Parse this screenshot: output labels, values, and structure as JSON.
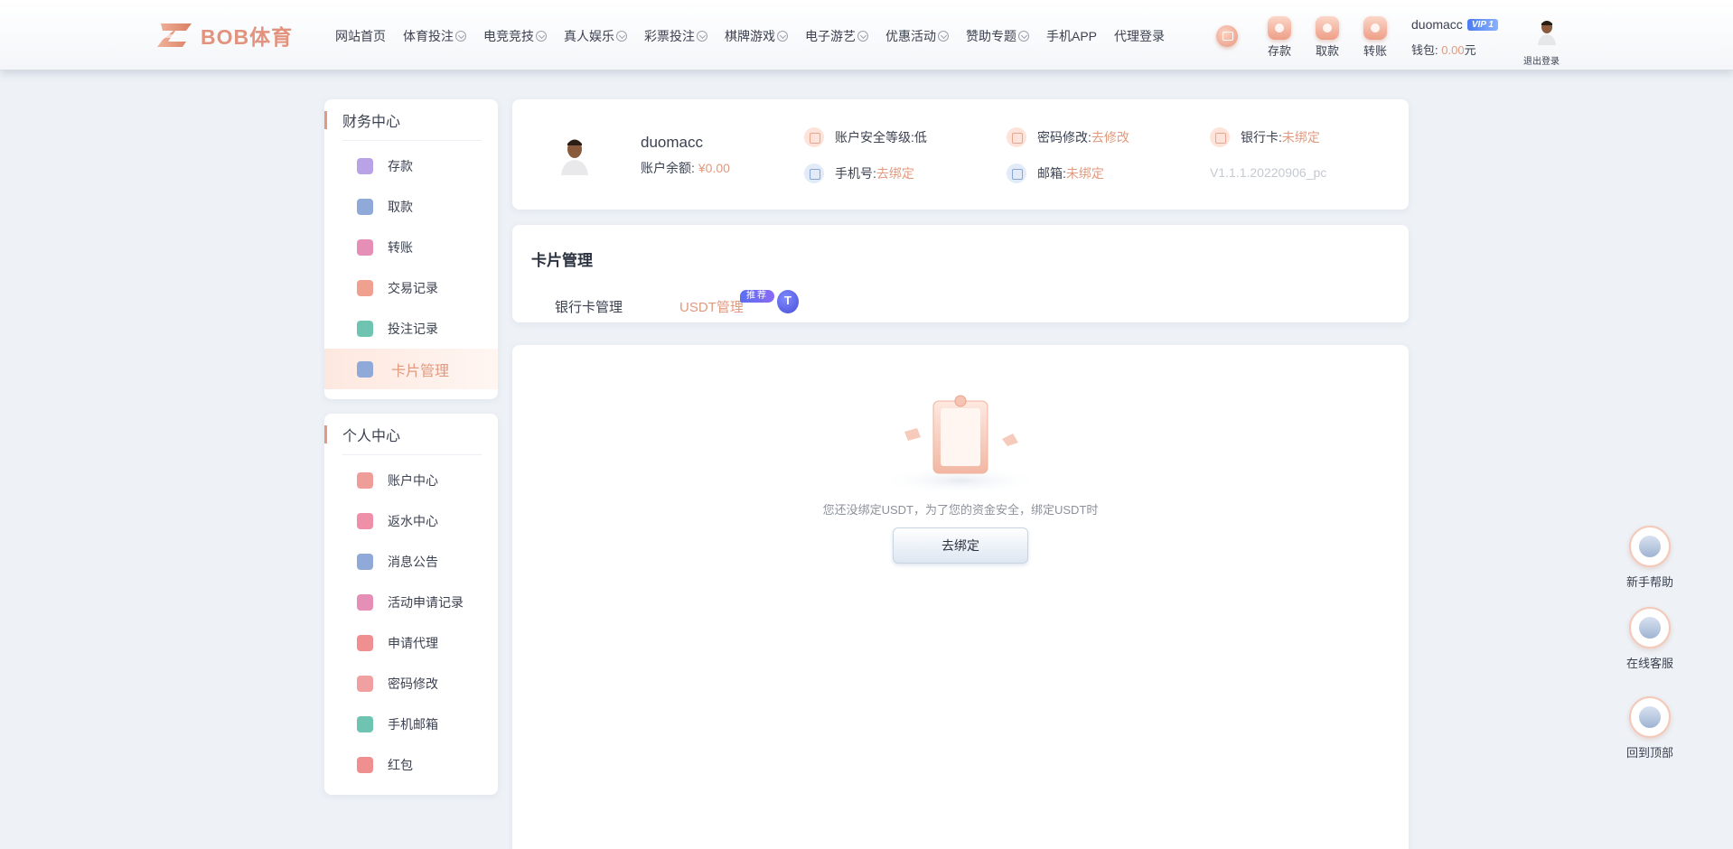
{
  "brand": {
    "name": "BOB体育"
  },
  "nav": [
    {
      "label": "网站首页",
      "caret": false
    },
    {
      "label": "体育投注",
      "caret": true
    },
    {
      "label": "电竞竞技",
      "caret": true
    },
    {
      "label": "真人娱乐",
      "caret": true
    },
    {
      "label": "彩票投注",
      "caret": true
    },
    {
      "label": "棋牌游戏",
      "caret": true
    },
    {
      "label": "电子游艺",
      "caret": true
    },
    {
      "label": "优惠活动",
      "caret": true
    },
    {
      "label": "赞助专题",
      "caret": true
    },
    {
      "label": "手机APP",
      "caret": false
    },
    {
      "label": "代理登录",
      "caret": false
    }
  ],
  "quick": {
    "deposit": "存款",
    "withdraw": "取款",
    "transfer": "转账"
  },
  "user": {
    "name": "duomacc",
    "vip": "VIP 1",
    "wallet_label": "钱包:",
    "wallet_amount": "0.00",
    "wallet_unit": "元",
    "logout": "退出登录"
  },
  "sidebar": {
    "finance_title": "财务中心",
    "finance_items": [
      {
        "label": "存款",
        "color": "#b9a3e6"
      },
      {
        "label": "取款",
        "color": "#8fa9d9"
      },
      {
        "label": "转账",
        "color": "#e68fb6"
      },
      {
        "label": "交易记录",
        "color": "#f0a08f"
      },
      {
        "label": "投注记录",
        "color": "#6fc3b1"
      },
      {
        "label": "卡片管理",
        "color": "#8fa9d9",
        "active": true
      }
    ],
    "personal_title": "个人中心",
    "personal_items": [
      {
        "label": "账户中心",
        "color": "#ef9d98"
      },
      {
        "label": "返水中心",
        "color": "#ef8fa8"
      },
      {
        "label": "消息公告",
        "color": "#8fa9d9"
      },
      {
        "label": "活动申请记录",
        "color": "#e68fb6"
      },
      {
        "label": "申请代理",
        "color": "#f08f8f"
      },
      {
        "label": "密码修改",
        "color": "#f0a0a0"
      },
      {
        "label": "手机邮箱",
        "color": "#6fc3b1"
      },
      {
        "label": "红包",
        "color": "#f08f8f"
      }
    ]
  },
  "profile": {
    "name": "duomacc",
    "balance_label": "账户余额:",
    "balance": "¥0.00",
    "security_label": "账户安全等级:",
    "security_value": "低",
    "password_label": "密码修改:",
    "password_action": "去修改",
    "bank_label": "银行卡:",
    "bank_value": "未绑定",
    "phone_label": "手机号:",
    "phone_action": "去绑定",
    "email_label": "邮箱:",
    "email_value": "未绑定",
    "version": "V1.1.1.20220906_pc"
  },
  "cards": {
    "title": "卡片管理",
    "tab_bank": "银行卡管理",
    "tab_usdt": "USDT管理",
    "badge": "推荐",
    "usdt_symbol": "T"
  },
  "empty": {
    "message": "您还没绑定USDT，为了您的资金安全，绑定USDT时",
    "button": "去绑定"
  },
  "float": {
    "help": "新手帮助",
    "service": "在线客服",
    "top": "回到顶部"
  },
  "colors": {
    "accent": "#e19a7f",
    "background": "#eef2f7",
    "vip": "#4b7cf0"
  }
}
